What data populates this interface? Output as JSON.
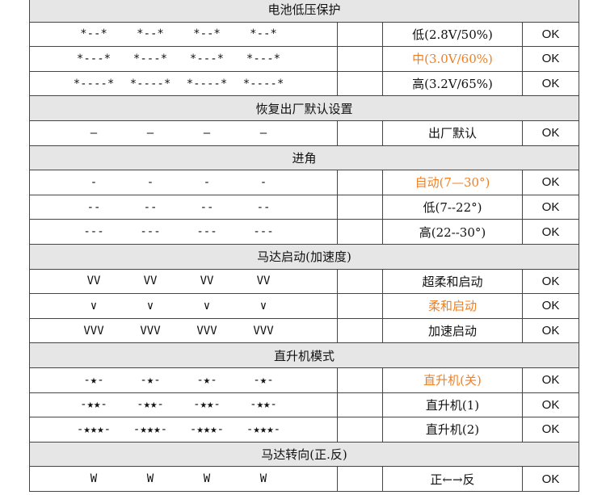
{
  "sections": [
    {
      "title": "电池低压保护",
      "rows": [
        {
          "pattern": [
            "*--*",
            "*--*",
            "*--*",
            "*--*"
          ],
          "option": "低(2.8V/50%)",
          "status": "OK",
          "highlight": false
        },
        {
          "pattern": [
            "*---*",
            "*---*",
            "*---*",
            "*---*"
          ],
          "option": "中(3.0V/60%)",
          "status": "OK",
          "highlight": true
        },
        {
          "pattern": [
            "*----*",
            "*----*",
            "*----*",
            "*----*"
          ],
          "option": "高(3.2V/65%)",
          "status": "OK",
          "highlight": false
        }
      ]
    },
    {
      "title": "恢复出厂默认设置",
      "rows": [
        {
          "pattern": [
            "—",
            "—",
            "—",
            "—"
          ],
          "option": "出厂默认",
          "status": "OK",
          "highlight": false
        }
      ]
    },
    {
      "title": "进角",
      "rows": [
        {
          "pattern": [
            "-",
            "-",
            "-",
            "-"
          ],
          "option": "自动(7—30°)",
          "status": "OK",
          "highlight": true
        },
        {
          "pattern": [
            "--",
            "--",
            "--",
            "--"
          ],
          "option": "低(7--22°)",
          "status": "OK",
          "highlight": false
        },
        {
          "pattern": [
            "---",
            "---",
            "---",
            "---"
          ],
          "option": "高(22--30°)",
          "status": "OK",
          "highlight": false
        }
      ]
    },
    {
      "title": "马达启动(加速度)",
      "rows": [
        {
          "pattern": [
            "VV",
            "VV",
            "VV",
            "VV"
          ],
          "option": "超柔和启动",
          "status": "OK",
          "highlight": false
        },
        {
          "pattern": [
            "∨",
            "∨",
            "∨",
            "∨"
          ],
          "option": "柔和启动",
          "status": "OK",
          "highlight": true
        },
        {
          "pattern": [
            "VVV",
            "VVV",
            "VVV",
            "VVV"
          ],
          "option": "加速启动",
          "status": "OK",
          "highlight": false
        }
      ]
    },
    {
      "title": "直升机模式",
      "rows": [
        {
          "pattern": [
            "-★-",
            "-★-",
            "-★-",
            "-★-"
          ],
          "option": "直升机(关)",
          "status": "OK",
          "highlight": true
        },
        {
          "pattern": [
            "-★★-",
            "-★★-",
            "-★★-",
            "-★★-"
          ],
          "option": "直升机(1)",
          "status": "OK",
          "highlight": false
        },
        {
          "pattern": [
            "-★★★-",
            "-★★★-",
            "-★★★-",
            "-★★★-"
          ],
          "option": "直升机(2)",
          "status": "OK",
          "highlight": false
        }
      ]
    },
    {
      "title": "马达转向(正.反)",
      "rows": [
        {
          "pattern": [
            "W",
            "W",
            "W",
            "W"
          ],
          "option": "正←→反",
          "status": "OK",
          "highlight": false
        }
      ]
    }
  ],
  "colors": {
    "highlight": "#f07f22",
    "section_bg": "#e6e6e6",
    "border": "#444444"
  }
}
